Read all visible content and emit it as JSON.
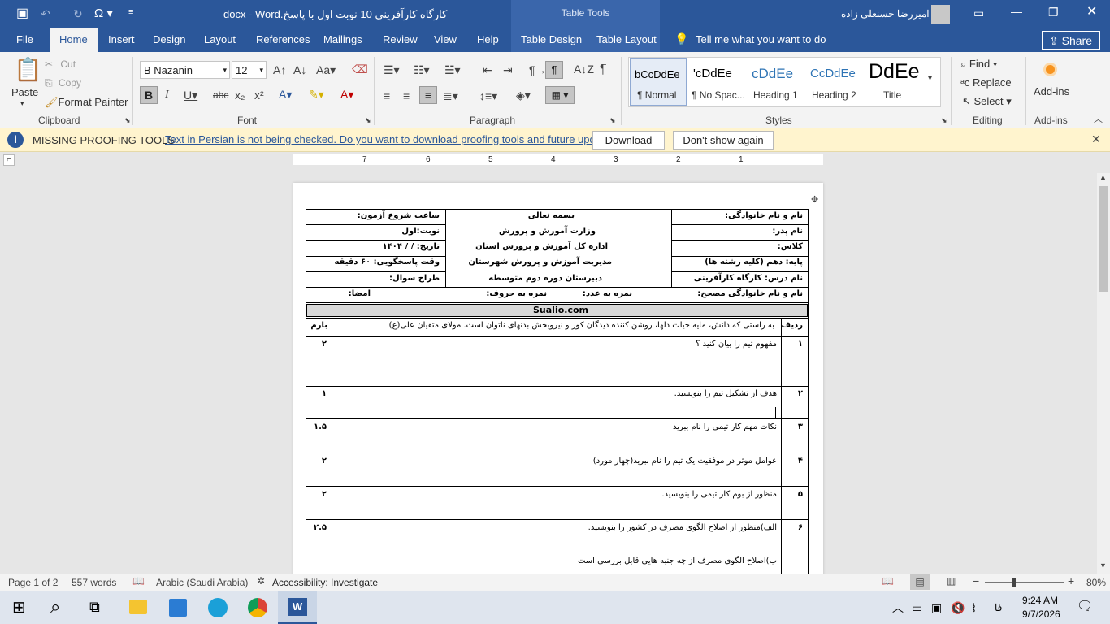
{
  "title": {
    "doc_name": "کارگاه کارآفرینی 10 نوبت اول با پاسخ.docx - Word",
    "table_tools": "Table Tools",
    "user": "امیررضا حسنعلی زاده"
  },
  "tabs": {
    "file": "File",
    "home": "Home",
    "insert": "Insert",
    "design": "Design",
    "layout": "Layout",
    "references": "References",
    "mailings": "Mailings",
    "review": "Review",
    "view": "View",
    "help": "Help",
    "table_design": "Table Design",
    "table_layout": "Table Layout",
    "tell_me": "Tell me what you want to do",
    "share": "Share"
  },
  "clipboard": {
    "paste": "Paste",
    "cut": "Cut",
    "copy": "Copy",
    "format_painter": "Format Painter",
    "label": "Clipboard"
  },
  "font": {
    "name": "B Nazanin",
    "size": "12",
    "label": "Font"
  },
  "paragraph": {
    "label": "Paragraph"
  },
  "styles": {
    "items": [
      {
        "preview": "bCcDdEe",
        "name": "¶ Normal"
      },
      {
        "preview": "'cDdEe",
        "name": "¶ No Spac..."
      },
      {
        "preview": "cDdEe",
        "name": "Heading 1"
      },
      {
        "preview": "CcDdEe",
        "name": "Heading 2"
      },
      {
        "preview": "DdEe",
        "name": "Title"
      }
    ],
    "label": "Styles"
  },
  "editing": {
    "find": "Find",
    "replace": "Replace",
    "select": "Select",
    "label": "Editing"
  },
  "addins": {
    "btn": "Add-ins",
    "label": "Add-ins"
  },
  "message": {
    "title": "MISSING PROOFING TOOLS",
    "text": "Text in Persian is not being checked. Do you want to download proofing tools and future updates?",
    "download": "Download",
    "dont_show": "Don't show again"
  },
  "ruler": {
    "nums": [
      "7",
      "6",
      "5",
      "4",
      "3",
      "2",
      "1"
    ]
  },
  "doc": {
    "start_time": "ساعت شروع آزمون:",
    "besm": "بسمه تعالی",
    "name": "نام و نام خانوادگی:",
    "nobat": "نوبت:اول",
    "vezarat": "وزارت آموزش و پرورش",
    "father": "نام پدر:",
    "tarikh": "تاریخ:   /   /  ۱۴۰۴",
    "edare": "اداره کل آموزش و پرورش استان",
    "class": "کلاس:",
    "vaght": "وقت پاسخگویی: ۶۰ دقیقه",
    "modiriat": "مدیریت آموزش و پرورش شهرستان",
    "paye": "پایه: دهم (کلیه رشته ها)",
    "tarrah": "طراح سوال:",
    "dabirestan": "دبیرستان دوره دوم متوسطه",
    "dars": "نام درس: کارگاه کارآفرینی",
    "mosahhe": "نام و نام خانوادگی مصحح:",
    "nomre_adad": "نمره به عدد:",
    "nomre_horuf": "نمره به حروف:",
    "emza": "امضا:",
    "site": "Sualio.com",
    "radif": "ردیف",
    "barom": "بارم",
    "quote": "به راستی که دانش، مایه حیات دلها، روشن کننده دیدگان کور و نیروبخش بدنهای ناتوان است. مولای متقیان علی(ع)",
    "questions": [
      {
        "n": "۱",
        "q": "مفهوم تیم را بیان کنید ؟",
        "score": "۲"
      },
      {
        "n": "۲",
        "q": "هدف از تشکیل تیم را بنویسید.",
        "score": "۱"
      },
      {
        "n": "۳",
        "q": "نکات مهم کار تیمی را نام ببرید",
        "score": "۱.۵"
      },
      {
        "n": "۴",
        "q": "عوامل موثر در موفقیت یک تیم را نام ببرید(چهار مورد)",
        "score": "۲"
      },
      {
        "n": "۵",
        "q": "منظور از بوم کار تیمی را بنویسید.",
        "score": "۲"
      },
      {
        "n": "۶",
        "q": "الف)منظور از  اصلاح الگوی مصرف در کشور را بنویسید.",
        "q2": "ب)اصلاح الگوی مصرف از چه جنبه هایی قابل بررسی است",
        "score": "۲.۵"
      }
    ]
  },
  "status": {
    "page": "Page 1 of 2",
    "words": "557 words",
    "language": "Arabic (Saudi Arabia)",
    "accessibility": "Accessibility: Investigate",
    "zoom": "80%"
  },
  "taskbar": {
    "time": "9:24 AM",
    "date": "9/7/2026",
    "lang": "فا"
  }
}
